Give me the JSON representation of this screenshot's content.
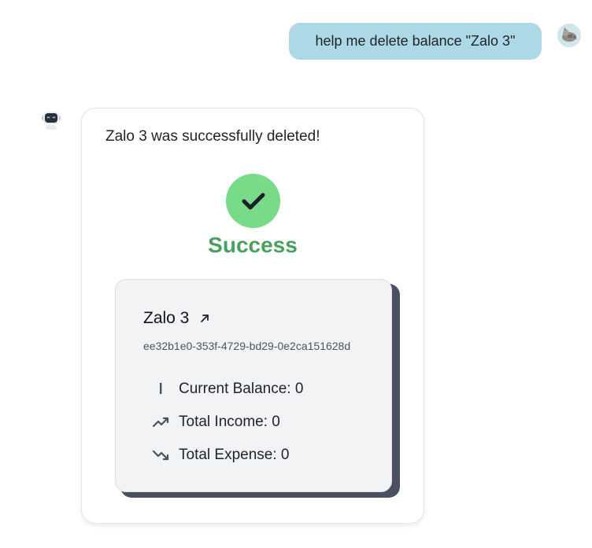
{
  "user_message": {
    "text": "help me delete balance \"Zalo 3\""
  },
  "bot_message": {
    "text": "Zalo 3 was successfully deleted!",
    "status_label": "Success",
    "balance": {
      "name": "Zalo 3",
      "id": "ee32b1e0-353f-4729-bd29-0e2ca151628d",
      "stats": [
        {
          "label": "Current Balance: 0",
          "icon": "balance-bar-icon"
        },
        {
          "label": "Total Income: 0",
          "icon": "trending-up-icon"
        },
        {
          "label": "Total Expense: 0",
          "icon": "trending-down-icon"
        }
      ]
    }
  },
  "colors": {
    "user_bubble": "#add8e6",
    "success_circle": "#77db87",
    "success_text": "#4aa05d",
    "card_shadow": "#4a5060",
    "card_bg": "#f2f3f5"
  }
}
